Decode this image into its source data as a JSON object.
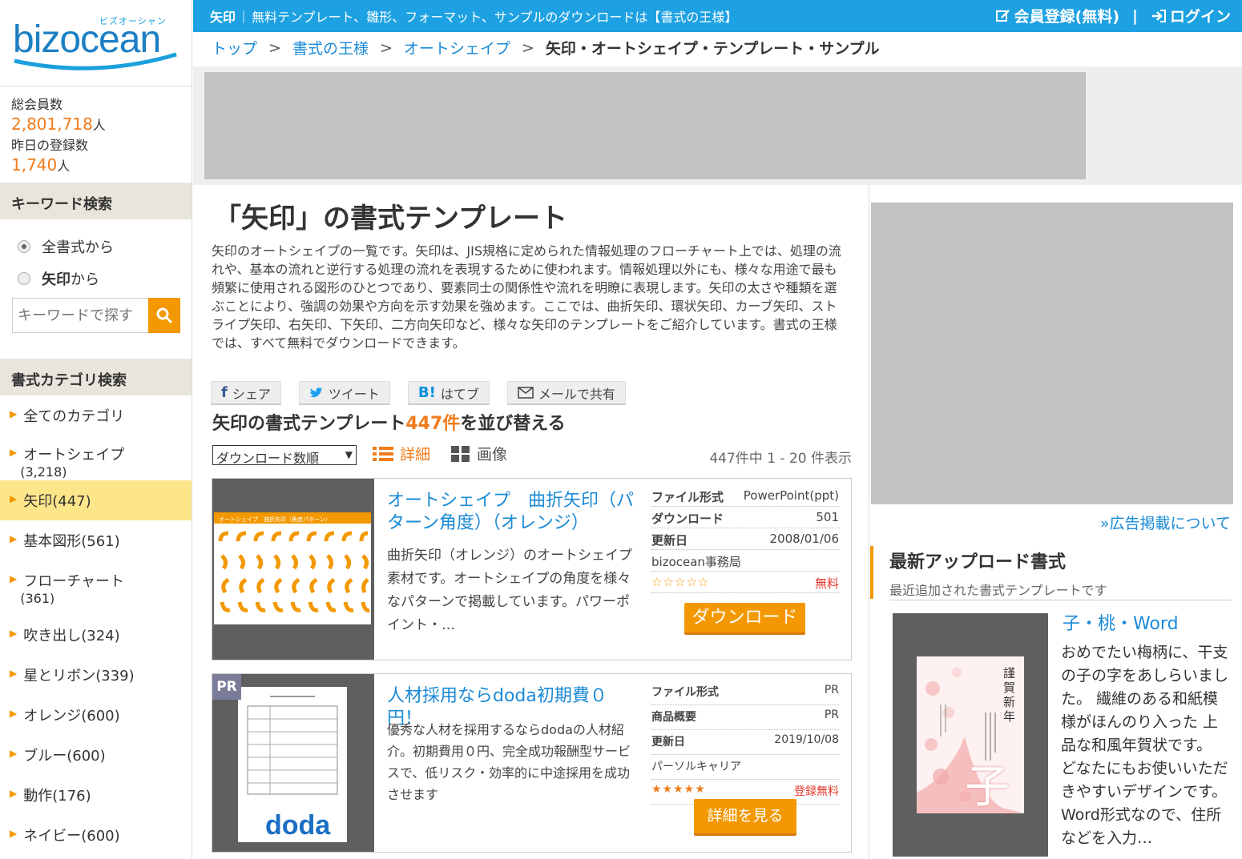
{
  "logo": {
    "kana": "ビズオーシャン",
    "word": "bizocean"
  },
  "stats": {
    "total_label": "総会員数",
    "total": "2,801,718",
    "unit": "人",
    "yesterday_label": "昨日の登録数",
    "yesterday": "1,740"
  },
  "topbar": {
    "keyword": "矢印",
    "sep": "｜",
    "tagline": "無料テンプレート、雛形、フォーマット、サンプルのダウンロードは【書式の王様】",
    "register": "会員登録(無料)",
    "divider": "|",
    "login": "ログイン"
  },
  "breadcrumb": {
    "items": [
      "トップ",
      "書式の王様",
      "オートシェイプ"
    ],
    "current": "矢印・オートシェイプ・テンプレート・サンプル",
    "sep": ">"
  },
  "sidebar": {
    "kw_head": "キーワード検索",
    "radio_all": "全書式から",
    "radio_kw_bold": "矢印",
    "radio_kw_rest": "から",
    "search_placeholder": "キーワードで探す",
    "cat_head": "書式カテゴリ検索",
    "cats": [
      {
        "label": "全てのカテゴリ",
        "count": ""
      },
      {
        "label": "オートシェイプ",
        "count": "(3,218)"
      },
      {
        "label": "矢印(447)",
        "count": ""
      },
      {
        "label": "基本図形(561)",
        "count": ""
      },
      {
        "label": "フローチャート",
        "count": "(361)"
      },
      {
        "label": "吹き出し(324)",
        "count": ""
      },
      {
        "label": "星とリボン(339)",
        "count": ""
      },
      {
        "label": "オレンジ(600)",
        "count": ""
      },
      {
        "label": "ブルー(600)",
        "count": ""
      },
      {
        "label": "動作(176)",
        "count": ""
      },
      {
        "label": "ネイビー(600)",
        "count": ""
      }
    ]
  },
  "main": {
    "title": "「矢印」の書式テンプレート",
    "intro": "矢印のオートシェイプの一覧です。矢印は、JIS規格に定められた情報処理のフローチャート上では、処理の流れや、基本の流れと逆行する処理の流れを表現するために使われます。情報処理以外にも、様々な用途で最も頻繁に使用される図形のひとつであり、要素同士の関係性や流れを明瞭に表現します。矢印の太さや種類を選ぶことにより、強調の効果や方向を示す効果を強めます。ここでは、曲折矢印、環状矢印、カーブ矢印、ストライプ矢印、右矢印、下矢印、二方向矢印など、様々な矢印のテンプレートをご紹介しています。書式の王様では、すべて無料でダウンロードできます。",
    "share": {
      "facebook": "シェア",
      "twitter": "ツイート",
      "hatena": "はてブ",
      "mail": "メールで共有"
    },
    "count_pre": "矢印の書式テンプレート",
    "count_num": "447件",
    "count_post": "を並び替える",
    "sort": "ダウンロード数順",
    "view_detail": "詳細",
    "view_image": "画像",
    "range": "447件中 1 - 20 件表示"
  },
  "cards": [
    {
      "title": "オートシェイプ　曲折矢印（パターン角度）（オレンジ）",
      "desc": "曲折矢印（オレンジ）のオートシェイプ素材です。オートシェイプの角度を様々なパターンで掲載しています。パワーポイント・…",
      "meta": [
        [
          "ファイル形式",
          "PowerPoint(ppt)"
        ],
        [
          "ダウンロード",
          "501"
        ],
        [
          "更新日",
          "2008/01/06"
        ]
      ],
      "author": "bizocean事務局",
      "stars": "☆☆☆☆☆",
      "price": "無料",
      "button": "ダウンロード",
      "thumb_header": "オートシェイプ　曲折矢印（角度パターン）"
    },
    {
      "badge": "PR",
      "title": "人材採用ならdoda初期費０円！",
      "desc": "優秀な人材を採用するならdodaの人材紹介。初期費用０円、完全成功報酬型サービスで、低リスク・効率的に中途採用を成功させます",
      "meta": [
        [
          "ファイル形式",
          "PR"
        ],
        [
          "商品概要",
          "PR"
        ],
        [
          "更新日",
          "2019/10/08"
        ]
      ],
      "author": "パーソルキャリア",
      "stars": "★★★★★",
      "price": "登録無料",
      "button": "詳細を見る",
      "thumb_logo": "doda"
    }
  ],
  "right": {
    "ad_link": "»広告掲載について",
    "new_title": "最新アップロード書式",
    "new_sub": "最近追加された書式テンプレートです",
    "item_title": "子・桃・Word",
    "item_desc": "おめでたい梅柄に、干支の子の字をあしらいました。 繊維のある和紙模様がほんのり入った 上品な和風年賀状です。 どなたにもお使いいただきやすいデザインです。 Word形式なので、住所などを入力…",
    "card_greeting": "謹賀新年",
    "card_kanji": "子"
  },
  "colors": {
    "accent": "#1da1e2",
    "orange": "#f39800",
    "link": "#1a8ad6"
  }
}
